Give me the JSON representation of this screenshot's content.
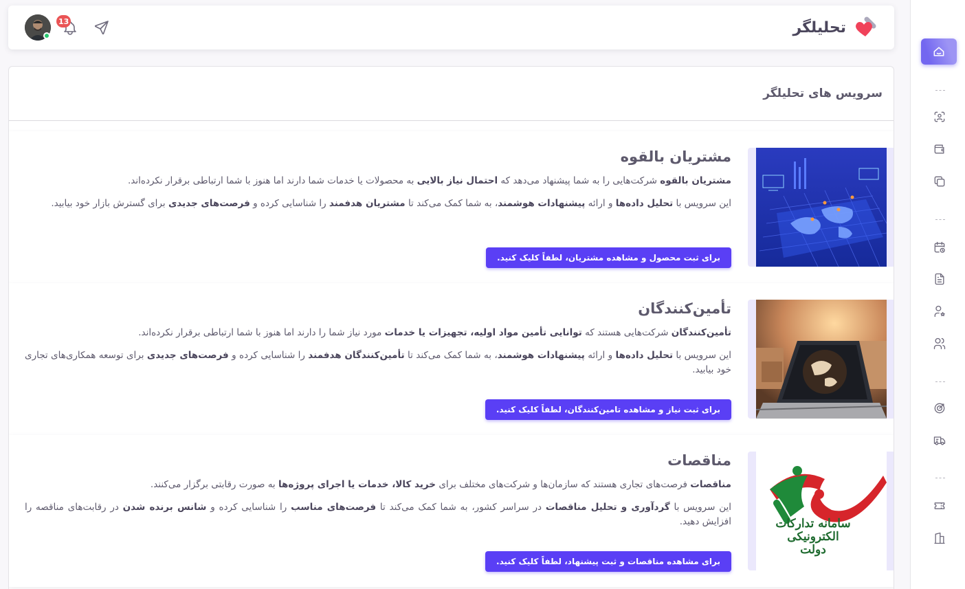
{
  "app": {
    "name": "تحلیلگر"
  },
  "notifications": {
    "count": "13"
  },
  "page": {
    "title": "سرویس های تحلیلگر"
  },
  "services": [
    {
      "title": "مشتریان بالقوه",
      "p1": [
        {
          "t": "مشتریان بالقوه",
          "b": true
        },
        {
          "t": " شرکت‌هایی را به شما پیشنهاد می‌دهد که ",
          "b": false
        },
        {
          "t": "احتمال نیاز بالایی",
          "b": true
        },
        {
          "t": " به محصولات یا خدمات شما دارند اما هنوز با شما ارتباطی برقرار نکرده‌اند.",
          "b": false
        }
      ],
      "p2": [
        {
          "t": "این سرویس با ",
          "b": false
        },
        {
          "t": "تحلیل داده‌ها",
          "b": true
        },
        {
          "t": " و ارائه ",
          "b": false
        },
        {
          "t": "پیشنهادات هوشمند",
          "b": true
        },
        {
          "t": "، به شما کمک می‌کند تا ",
          "b": false
        },
        {
          "t": "مشتریان هدفمند",
          "b": true
        },
        {
          "t": " را شناسایی کرده و ",
          "b": false
        },
        {
          "t": "فرصت‌های جدیدی",
          "b": true
        },
        {
          "t": " برای گسترش بازار خود بیابید.",
          "b": false
        }
      ],
      "button": "برای ثبت محصول و مشاهده مشتریان، لطفاً کلیک کنید."
    },
    {
      "title": "تأمین‌کنندگان",
      "p1": [
        {
          "t": "تأمین‌کنندگان",
          "b": true
        },
        {
          "t": " شرکت‌هایی هستند که ",
          "b": false
        },
        {
          "t": "توانایی تأمین مواد اولیه، تجهیزات یا خدمات",
          "b": true
        },
        {
          "t": " مورد نیاز شما را دارند اما هنوز با شما ارتباطی برقرار نکرده‌اند.",
          "b": false
        }
      ],
      "p2": [
        {
          "t": "این سرویس با ",
          "b": false
        },
        {
          "t": "تحلیل داده‌ها",
          "b": true
        },
        {
          "t": " و ارائه ",
          "b": false
        },
        {
          "t": "پیشنهادات هوشمند",
          "b": true
        },
        {
          "t": "، به شما کمک می‌کند تا ",
          "b": false
        },
        {
          "t": "تأمین‌کنندگان هدفمند",
          "b": true
        },
        {
          "t": " را شناسایی کرده و ",
          "b": false
        },
        {
          "t": "فرصت‌های جدیدی",
          "b": true
        },
        {
          "t": " برای توسعه همکاری‌های تجاری خود بیابید.",
          "b": false
        }
      ],
      "button": "برای ثبت نیاز و مشاهده تامین‌کنندگان، لطفاً کلیک کنید."
    },
    {
      "title": "مناقصات",
      "p1": [
        {
          "t": "مناقصات",
          "b": true
        },
        {
          "t": " فرصت‌های تجاری هستند که سازمان‌ها و شرکت‌های مختلف برای ",
          "b": false
        },
        {
          "t": "خرید کالا، خدمات یا اجرای پروژه‌ها",
          "b": true
        },
        {
          "t": " به صورت رقابتی برگزار می‌کنند.",
          "b": false
        }
      ],
      "p2": [
        {
          "t": "این سرویس با ",
          "b": false
        },
        {
          "t": "گردآوری و تحلیل مناقصات",
          "b": true
        },
        {
          "t": " در سراسر کشور، به شما کمک می‌کند تا ",
          "b": false
        },
        {
          "t": "فرصت‌های مناسب",
          "b": true
        },
        {
          "t": " را شناسایی کرده و ",
          "b": false
        },
        {
          "t": "شانس برنده شدن",
          "b": true
        },
        {
          "t": " در رقابت‌های مناقصه را افزایش دهید.",
          "b": false
        }
      ],
      "button": "برای مشاهده مناقصات و ثبت پیشنهاد، لطفاً کلیک کنید.",
      "logo_text": "سامانه تدارکات الکترونیکی دولت"
    }
  ],
  "icons": {
    "sidebar": [
      "home-icon",
      "face-scan-icon",
      "wallet-icon",
      "copy-icon",
      "calendar-clock-icon",
      "file-text-icon",
      "user-star-icon",
      "users-icon",
      "target-icon",
      "truck-icon",
      "ticket-icon",
      "building-icon"
    ]
  },
  "colors": {
    "accent": "#7367f0",
    "button": "#5a3ff5",
    "badge": "#ea5455",
    "online": "#28c76f"
  }
}
